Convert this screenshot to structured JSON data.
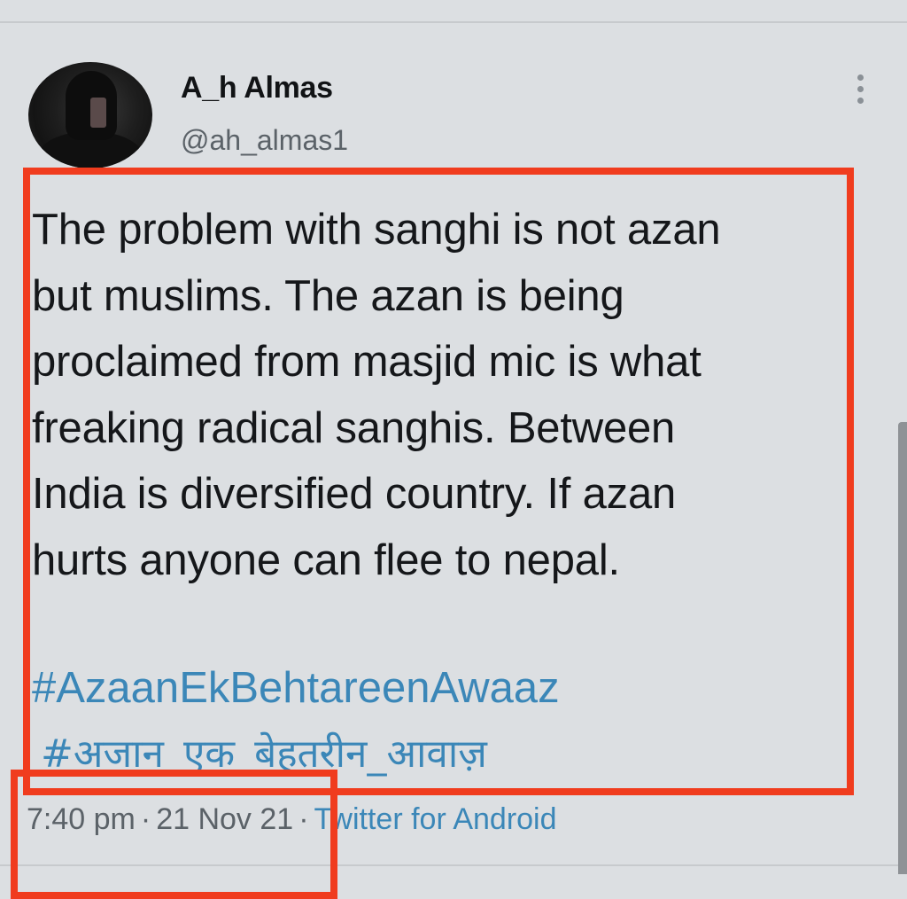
{
  "user": {
    "display_name": "A_h Almas",
    "handle": "@ah_almas1"
  },
  "tweet": {
    "text": "The problem with sanghi is not azan\nbut muslims. The azan is being\nproclaimed from masjid mic is what\nfreaking radical sanghis. Between\nIndia is diversified country. If azan\nhurts anyone can flee to nepal.",
    "hashtags": [
      "#AzaanEkBehtareenAwaaz",
      "#अजान_एक_बेहतरीन_आवाज़"
    ]
  },
  "meta": {
    "time": "7:40 pm",
    "separator": "·",
    "date": "21 Nov 21",
    "source": "Twitter for Android"
  },
  "icons": {
    "more": "more-vertical-icon"
  },
  "colors": {
    "background": "#dcdfe2",
    "link": "#3b87b8",
    "highlight": "#f03c1e",
    "secondary_text": "#5b6268"
  }
}
